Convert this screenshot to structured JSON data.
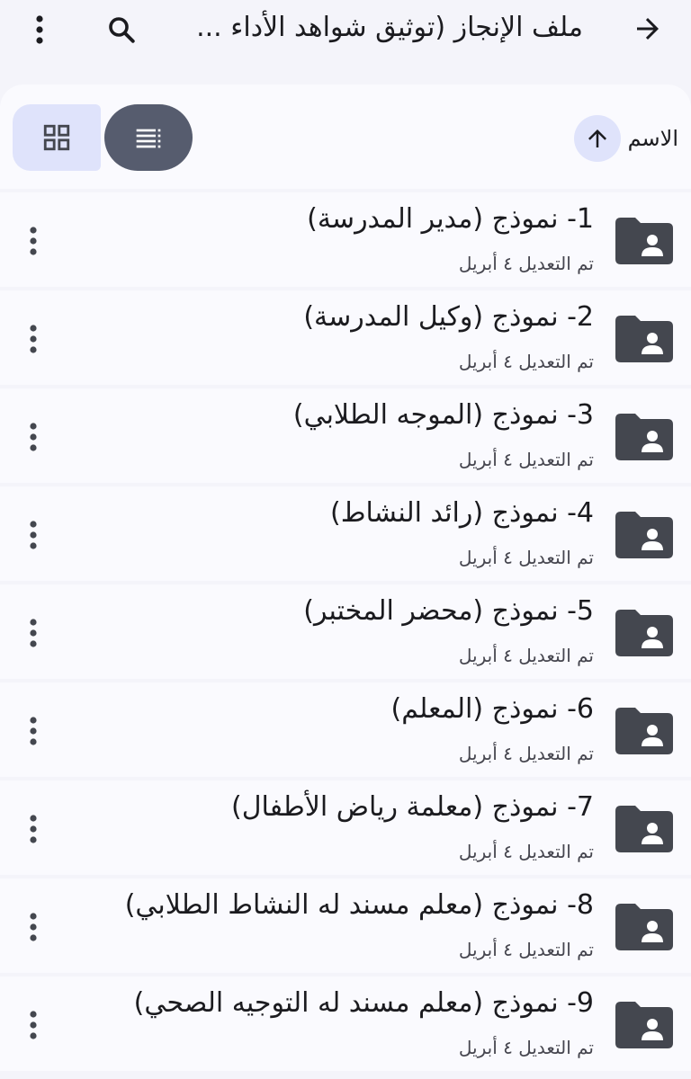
{
  "header": {
    "title": "ملف الإنجاز (توثيق شواهد الأداء ...",
    "back_icon": "arrow-right-icon",
    "search_icon": "search-icon",
    "overflow_icon": "more-vert-icon"
  },
  "sort_bar": {
    "sort_label": "الاسم",
    "sort_direction_icon": "arrow-up-icon",
    "view_options": [
      {
        "name": "grid-view",
        "icon": "grid-icon",
        "selected": false
      },
      {
        "name": "list-view",
        "icon": "list-icon",
        "selected": true
      }
    ]
  },
  "files": [
    {
      "name": "1- نموذج (مدير المدرسة)",
      "modified": "تم التعديل ٤ أبريل",
      "icon": "shared-folder-icon"
    },
    {
      "name": "2- نموذج (وكيل المدرسة)",
      "modified": "تم التعديل ٤ أبريل",
      "icon": "shared-folder-icon"
    },
    {
      "name": "3- نموذج (الموجه الطلابي)",
      "modified": "تم التعديل ٤ أبريل",
      "icon": "shared-folder-icon"
    },
    {
      "name": "4- نموذج (رائد النشاط)",
      "modified": "تم التعديل ٤ أبريل",
      "icon": "shared-folder-icon"
    },
    {
      "name": "5- نموذج (محضر المختبر)",
      "modified": "تم التعديل ٤ أبريل",
      "icon": "shared-folder-icon"
    },
    {
      "name": "6- نموذج (المعلم)",
      "modified": "تم التعديل ٤ أبريل",
      "icon": "shared-folder-icon"
    },
    {
      "name": "7- نموذج (معلمة رياض الأطفال)",
      "modified": "تم التعديل ٤ أبريل",
      "icon": "shared-folder-icon"
    },
    {
      "name": "8- نموذج (معلم مسند له النشاط الطلابي)",
      "modified": "تم التعديل ٤ أبريل",
      "icon": "shared-folder-icon"
    },
    {
      "name": "9- نموذج (معلم مسند له التوجيه الصحي)",
      "modified": "تم التعديل ٤ أبريل",
      "icon": "shared-folder-icon"
    }
  ],
  "colors": {
    "background": "#f4f4fa",
    "surface": "#fafafe",
    "accent_container": "#dfe3fb",
    "selected_toggle": "#565c6e",
    "icon": "#44474f"
  }
}
